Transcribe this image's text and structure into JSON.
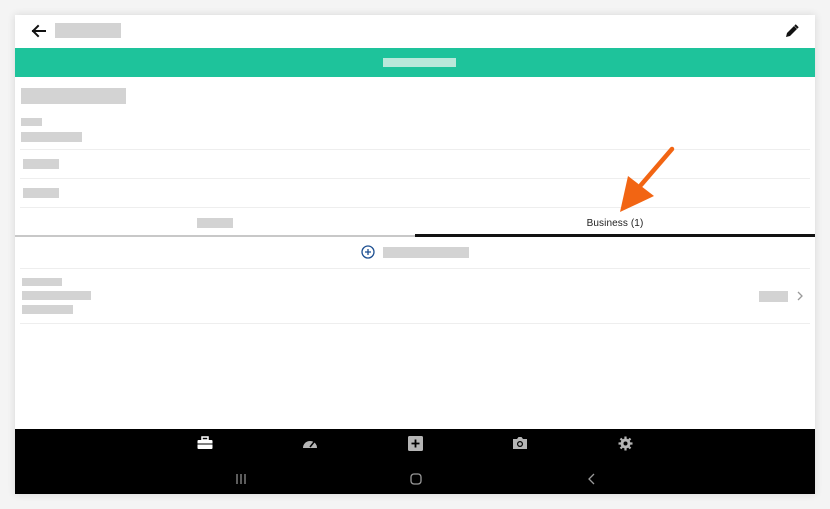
{
  "header": {
    "back_icon": "arrow-left-icon",
    "edit_icon": "pencil-icon"
  },
  "colors": {
    "accent": "#1ec39b",
    "annotation_arrow": "#f26513",
    "nav_background": "#000000",
    "add_icon": "#1d4f91"
  },
  "tabs": [
    {
      "label": ""
    },
    {
      "label": "Business (1)"
    }
  ],
  "bottom_nav": {
    "items": [
      "briefcase-icon",
      "speedometer-icon",
      "plus-square-icon",
      "camera-icon",
      "gear-icon"
    ]
  },
  "system_nav": {
    "items": [
      "recents-icon",
      "home-icon",
      "back-icon"
    ]
  }
}
